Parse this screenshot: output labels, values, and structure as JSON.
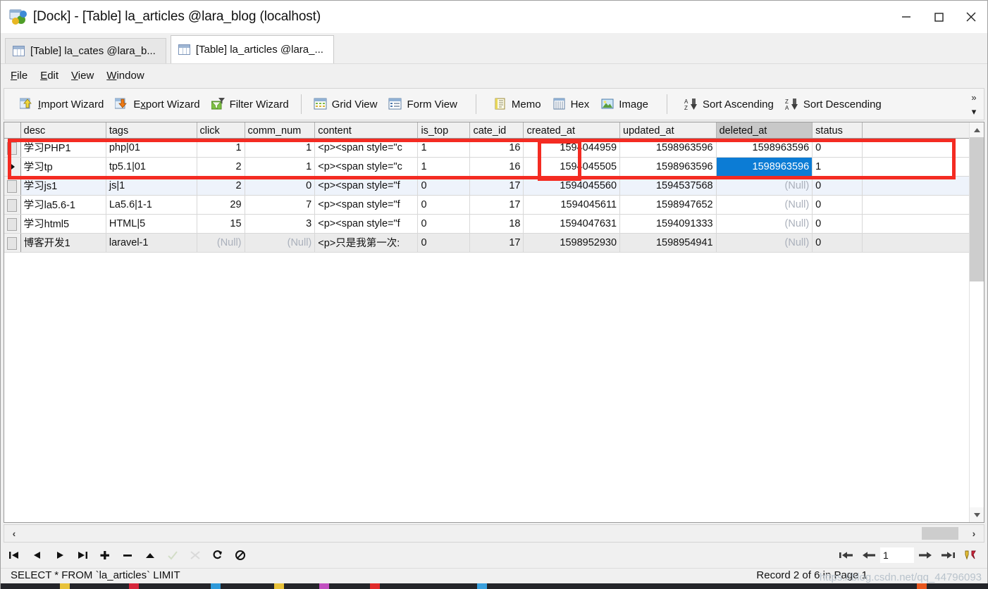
{
  "window": {
    "title": "[Dock] - [Table] la_articles @lara_blog (localhost)",
    "app_icon": "navicat-icon",
    "minimize_label": "–",
    "maximize_label": "□",
    "close_label": "✕"
  },
  "tabs": [
    {
      "label": "[Table] la_cates @lara_b...",
      "icon": "table-grid-icon",
      "active": false
    },
    {
      "label": "[Table] la_articles @lara_...",
      "icon": "table-grid-icon",
      "active": true
    }
  ],
  "menu": [
    {
      "label": "File",
      "accel": "F"
    },
    {
      "label": "Edit",
      "accel": "E"
    },
    {
      "label": "View",
      "accel": "V"
    },
    {
      "label": "Window",
      "accel": "W"
    }
  ],
  "toolbar": {
    "groups": [
      [
        {
          "label": "Import Wizard",
          "icon": "import-wizard-icon"
        },
        {
          "label": "Export Wizard",
          "icon": "export-wizard-icon"
        },
        {
          "label": "Filter Wizard",
          "icon": "filter-wizard-icon"
        }
      ],
      [
        {
          "label": "Grid View",
          "icon": "grid-view-icon"
        },
        {
          "label": "Form View",
          "icon": "form-view-icon"
        }
      ],
      [
        {
          "label": "Memo",
          "icon": "memo-icon"
        },
        {
          "label": "Hex",
          "icon": "hex-icon"
        },
        {
          "label": "Image",
          "icon": "image-icon"
        }
      ],
      [
        {
          "label": "Sort Ascending",
          "icon": "sort-ascending-icon"
        },
        {
          "label": "Sort Descending",
          "icon": "sort-descending-icon"
        }
      ]
    ],
    "overflow_label": "»",
    "overflow_caret": "▾"
  },
  "grid": {
    "columns": [
      {
        "key": "desc",
        "label": "desc",
        "align": "left",
        "selected": false
      },
      {
        "key": "tags",
        "label": "tags",
        "align": "left",
        "selected": false
      },
      {
        "key": "click",
        "label": "click",
        "align": "right",
        "selected": false
      },
      {
        "key": "comm_num",
        "label": "comm_num",
        "align": "right",
        "selected": false
      },
      {
        "key": "content",
        "label": "content",
        "align": "left",
        "selected": false
      },
      {
        "key": "is_top",
        "label": "is_top",
        "align": "left",
        "selected": false
      },
      {
        "key": "cate_id",
        "label": "cate_id",
        "align": "right",
        "selected": false
      },
      {
        "key": "created_at",
        "label": "created_at",
        "align": "right",
        "selected": false
      },
      {
        "key": "updated_at",
        "label": "updated_at",
        "align": "right",
        "selected": false
      },
      {
        "key": "deleted_at",
        "label": "deleted_at",
        "align": "right",
        "selected": true
      },
      {
        "key": "status",
        "label": "status",
        "align": "left",
        "selected": false
      }
    ],
    "rows": [
      {
        "current": false,
        "banding": "white",
        "desc": "学习PHP1",
        "tags": "php|01",
        "click": "1",
        "comm_num": "1",
        "content": "<p><span style=\"c",
        "is_top": "1",
        "cate_id": "16",
        "created_at": "1594044959",
        "updated_at": "1598963596",
        "deleted_at": "1598963596",
        "status": "0",
        "deleted_at_null": false,
        "selected_cell": null
      },
      {
        "current": true,
        "banding": "white",
        "desc": "学习tp",
        "tags": "tp5.1|01",
        "click": "2",
        "comm_num": "1",
        "content": "<p><span style=\"c",
        "is_top": "1",
        "cate_id": "16",
        "created_at": "1594045505",
        "updated_at": "1598963596",
        "deleted_at": "1598963596",
        "status": "1",
        "deleted_at_null": false,
        "selected_cell": "deleted_at"
      },
      {
        "current": false,
        "banding": "alt",
        "desc": "学习js1",
        "tags": "js|1",
        "click": "2",
        "comm_num": "0",
        "content": "<p><span style=\"f",
        "is_top": "0",
        "cate_id": "17",
        "created_at": "1594045560",
        "updated_at": "1594537568",
        "deleted_at": "(Null)",
        "status": "0",
        "deleted_at_null": true,
        "selected_cell": null
      },
      {
        "current": false,
        "banding": "white",
        "desc": "学习la5.6-1",
        "tags": "La5.6|1-1",
        "click": "29",
        "comm_num": "7",
        "content": "<p><span style=\"f",
        "is_top": "0",
        "cate_id": "17",
        "created_at": "1594045611",
        "updated_at": "1598947652",
        "deleted_at": "(Null)",
        "status": "0",
        "deleted_at_null": true,
        "selected_cell": null
      },
      {
        "current": false,
        "banding": "white",
        "desc": "学习html5",
        "tags": "HTML|5",
        "click": "15",
        "comm_num": "3",
        "content": "<p><span style=\"f",
        "is_top": "0",
        "cate_id": "18",
        "created_at": "1594047631",
        "updated_at": "1594091333",
        "deleted_at": "(Null)",
        "status": "0",
        "deleted_at_null": true,
        "selected_cell": null
      },
      {
        "current": false,
        "banding": "gray",
        "desc": "博客开发1",
        "tags": "laravel-1",
        "click": "(Null)",
        "comm_num": "(Null)",
        "content": "<p>只是我第一次:",
        "is_top": "0",
        "cate_id": "17",
        "created_at": "1598952930",
        "updated_at": "1598954941",
        "deleted_at": "(Null)",
        "status": "0",
        "deleted_at_null": true,
        "click_null": true,
        "comm_null": true,
        "selected_cell": null
      }
    ],
    "current_row_marker": "▶"
  },
  "navbar": {
    "buttons": [
      {
        "name": "first-record-button",
        "glyph": "⏮",
        "disabled": false
      },
      {
        "name": "previous-record-button",
        "glyph": "◀",
        "disabled": false
      },
      {
        "name": "next-record-button",
        "glyph": "▶",
        "disabled": false
      },
      {
        "name": "last-record-button",
        "glyph": "⏭",
        "disabled": false
      },
      {
        "name": "add-record-button",
        "glyph": "✚",
        "disabled": false
      },
      {
        "name": "delete-record-button",
        "glyph": "━",
        "disabled": false
      },
      {
        "name": "apply-change-button",
        "glyph": "▲",
        "disabled": false
      },
      {
        "name": "confirm-button",
        "glyph": "✓",
        "disabled": true
      },
      {
        "name": "cancel-button",
        "glyph": "✂",
        "disabled": true
      },
      {
        "name": "refresh-button",
        "glyph": "↻",
        "disabled": false
      },
      {
        "name": "stop-button",
        "glyph": "Ø",
        "disabled": false
      }
    ],
    "page": {
      "first_glyph": "⇤",
      "prev_glyph": "⇠",
      "value": "1",
      "next_glyph": "⇢",
      "last_glyph": "⇥",
      "settings_icon": "page-settings-icon"
    }
  },
  "scrollbars": {
    "v_up": "⌃",
    "v_down": "⌄",
    "h_left": "‹",
    "h_right": "›"
  },
  "statusbar": {
    "query": "SELECT * FROM `la_articles` LIMIT",
    "record_info": "Record 2 of 6 in Page 1",
    "watermark": "https://blog.csdn.net/qq_44796093"
  },
  "colors": {
    "selection_blue": "#0c7cd5",
    "annotation_red": "#f42b22",
    "header_selected": "#c8c8c8",
    "alt_row": "#eef3fb",
    "gray_row": "#ebebeb"
  }
}
